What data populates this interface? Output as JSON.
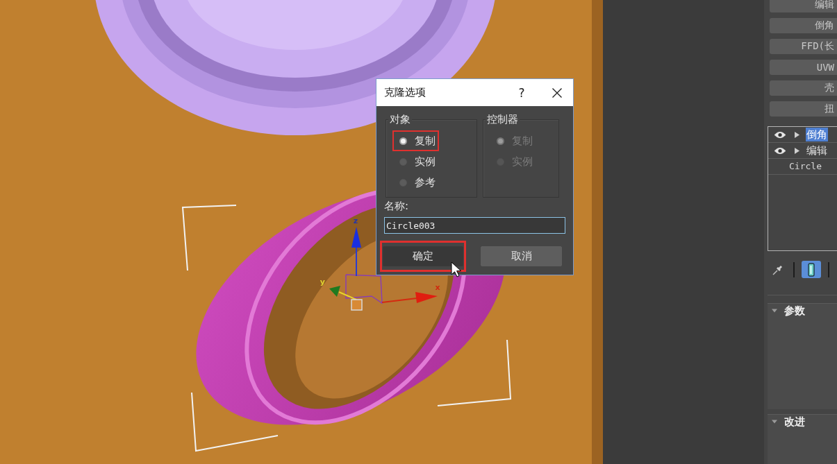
{
  "viewport": {
    "gizmo_axes": [
      {
        "label": "z"
      },
      {
        "label": "x"
      },
      {
        "label": "y"
      }
    ]
  },
  "dialog": {
    "title": "克隆选项",
    "help": "?",
    "groups": [
      {
        "title": "对象",
        "disabled": false,
        "options": [
          {
            "label": "复制",
            "selected": true,
            "highlighted": true
          },
          {
            "label": "实例",
            "selected": false,
            "highlighted": false
          },
          {
            "label": "参考",
            "selected": false,
            "highlighted": false
          }
        ]
      },
      {
        "title": "控制器",
        "disabled": true,
        "options": [
          {
            "label": "复制",
            "selected": true,
            "highlighted": false
          },
          {
            "label": "实例",
            "selected": false,
            "highlighted": false
          }
        ]
      }
    ],
    "name_label": "名称:",
    "name_value": "Circle003",
    "buttons": [
      {
        "label": "确定",
        "kind": "primary",
        "highlighted": true
      },
      {
        "label": "取消",
        "kind": "secondary",
        "highlighted": false
      }
    ]
  },
  "command_panel": {
    "modifier_buttons": [
      "编辑",
      "倒角",
      "FFD(长",
      "UVW",
      "壳",
      "扭"
    ],
    "stack": [
      {
        "label": "倒角",
        "kind": "modifier",
        "on": true,
        "selected": true
      },
      {
        "label": "编辑",
        "kind": "modifier",
        "on": true,
        "selected": false
      },
      {
        "label": "Circle",
        "kind": "base",
        "selected": false
      }
    ],
    "toolbar": [
      {
        "kind": "pin",
        "selected": false
      },
      {
        "kind": "end-result",
        "selected": true
      }
    ],
    "rollouts": [
      {
        "title": "参数",
        "expanded": true
      },
      {
        "title": "改进",
        "expanded": true
      }
    ]
  }
}
